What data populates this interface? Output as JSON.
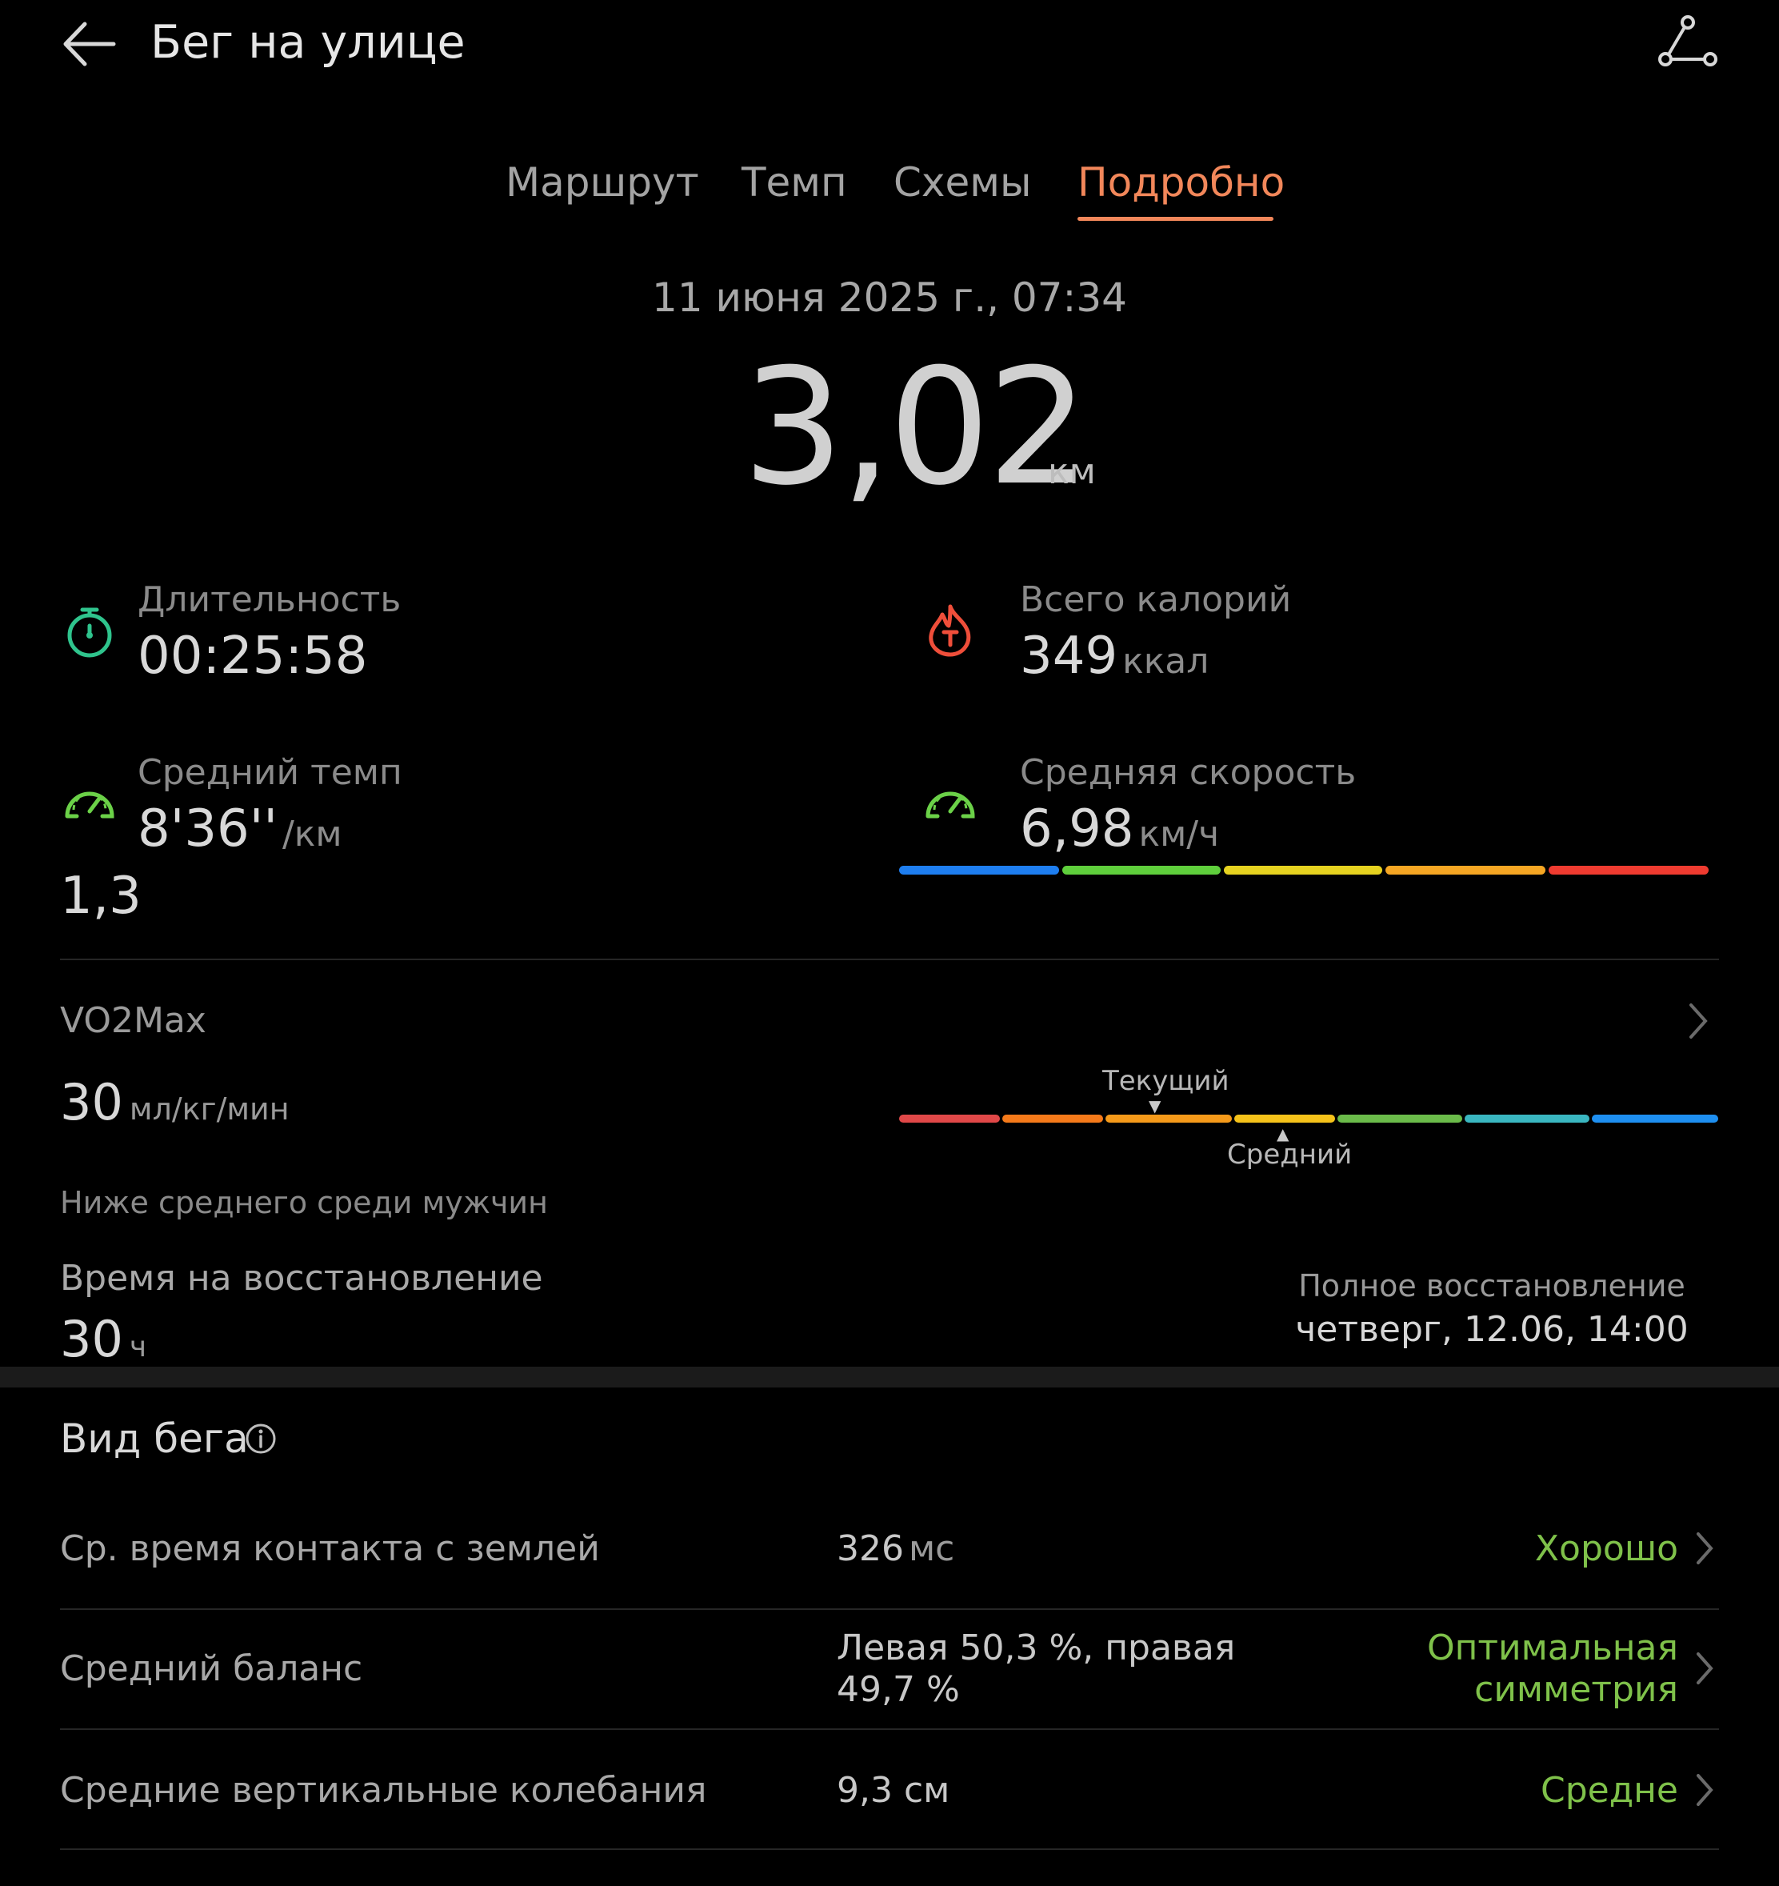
{
  "header": {
    "title": "Бег на улице",
    "back_icon": "arrow-left-icon",
    "route_icon": "route-share-icon"
  },
  "tabs": [
    {
      "label": "Маршрут",
      "active": false
    },
    {
      "label": "Темп",
      "active": false
    },
    {
      "label": "Схемы",
      "active": false
    },
    {
      "label": "Подробно",
      "active": true
    }
  ],
  "summary": {
    "date": "11 июня 2025 г., 07:34",
    "distance": "3,02",
    "distance_unit": "км"
  },
  "stats": {
    "duration": {
      "label": "Длительность",
      "value": "00:25:58",
      "icon": "stopwatch-icon"
    },
    "calories": {
      "label": "Всего калорий",
      "value": "349",
      "unit": "ккал",
      "icon": "flame-icon"
    },
    "pace": {
      "label": "Средний темп",
      "value": "8'36''",
      "unit": "/км",
      "icon": "speedometer-icon",
      "extra": "1,3"
    },
    "speed": {
      "label": "Средняя скорость",
      "value": "6,98",
      "unit": "км/ч",
      "icon": "gauge-icon"
    }
  },
  "speed_bar_colors": [
    "#1e7ef0",
    "#5fcf3c",
    "#e6d220",
    "#f5a623",
    "#ef3b30"
  ],
  "vo2": {
    "label": "VO2Max",
    "value": "30",
    "unit": "мл/кг/мин",
    "note": "Ниже среднего среди мужчин",
    "current_label": "Текущий",
    "average_label": "Средний",
    "scale_colors": [
      "#e04848",
      "#f57a1a",
      "#f59a1a",
      "#f5c21a",
      "#6bbb4a",
      "#3ab6c0",
      "#1e8ff0"
    ]
  },
  "recovery": {
    "label": "Время на восстановление",
    "value": "30",
    "unit": "ч",
    "full_label": "Полное восстановление",
    "full_value": "четверг, 12.06, 14:00"
  },
  "run_type": {
    "title": "Вид бега",
    "info_icon": "info-icon",
    "rows": [
      {
        "label": "Ср. время контакта с землей",
        "value": "326",
        "unit": "мс",
        "rating": "Хорошо"
      },
      {
        "label": "Средний баланс",
        "value_line1": "Левая 50,3 %, правая",
        "value_line2": "49,7 %",
        "rating_line1": "Оптимальная",
        "rating_line2": "симметрия"
      },
      {
        "label": "Средние вертикальные колебания",
        "value": "9,3 см",
        "rating": "Средне"
      }
    ]
  },
  "colors": {
    "accent": "#f2875a",
    "good": "#7fc14a"
  }
}
